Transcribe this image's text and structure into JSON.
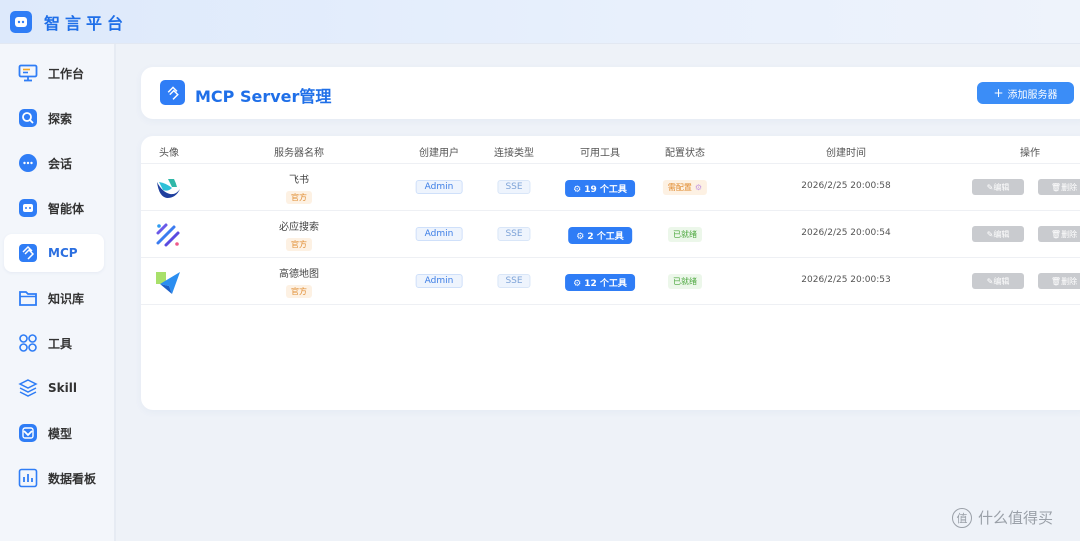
{
  "app": {
    "title": "智言平台"
  },
  "sidebar": {
    "items": [
      {
        "label": "工作台",
        "icon": "monitor-icon"
      },
      {
        "label": "探索",
        "icon": "explore-icon"
      },
      {
        "label": "会话",
        "icon": "chat-icon"
      },
      {
        "label": "智能体",
        "icon": "robot-icon"
      },
      {
        "label": "MCP",
        "icon": "mcp-icon",
        "active": true
      },
      {
        "label": "知识库",
        "icon": "folder-icon"
      },
      {
        "label": "工具",
        "icon": "grid-icon"
      },
      {
        "label": "Skill",
        "icon": "layers-icon"
      },
      {
        "label": "模型",
        "icon": "model-icon"
      },
      {
        "label": "数据看板",
        "icon": "chart-icon"
      }
    ]
  },
  "header": {
    "title": "MCP Server管理",
    "add_button": "添加服务器"
  },
  "table": {
    "columns": [
      "头像",
      "服务器名称",
      "创建用户",
      "连接类型",
      "可用工具",
      "配置状态",
      "创建时间",
      "操作"
    ],
    "rows": [
      {
        "name": "飞书",
        "badge": "官方",
        "user": "Admin",
        "type": "SSE",
        "tools": "19 个工具",
        "status": "需配置",
        "time": "2026/2/25 20:00:58",
        "avatar": "feishu-logo"
      },
      {
        "name": "必应搜索",
        "badge": "官方",
        "user": "Admin",
        "type": "SSE",
        "tools": "2 个工具",
        "status": "已就绪",
        "time": "2026/2/25 20:00:54",
        "avatar": "bing-search-logo"
      },
      {
        "name": "高德地图",
        "badge": "官方",
        "user": "Admin",
        "type": "SSE",
        "tools": "12 个工具",
        "status": "已就绪",
        "time": "2026/2/25 20:00:53",
        "avatar": "amap-logo"
      }
    ],
    "actions": {
      "edit": "编辑",
      "delete": "删除"
    }
  },
  "watermark": "什么值得买",
  "colors": {
    "primary": "#2f7df6",
    "pending": "#e0892b",
    "ready": "#49a63b"
  }
}
